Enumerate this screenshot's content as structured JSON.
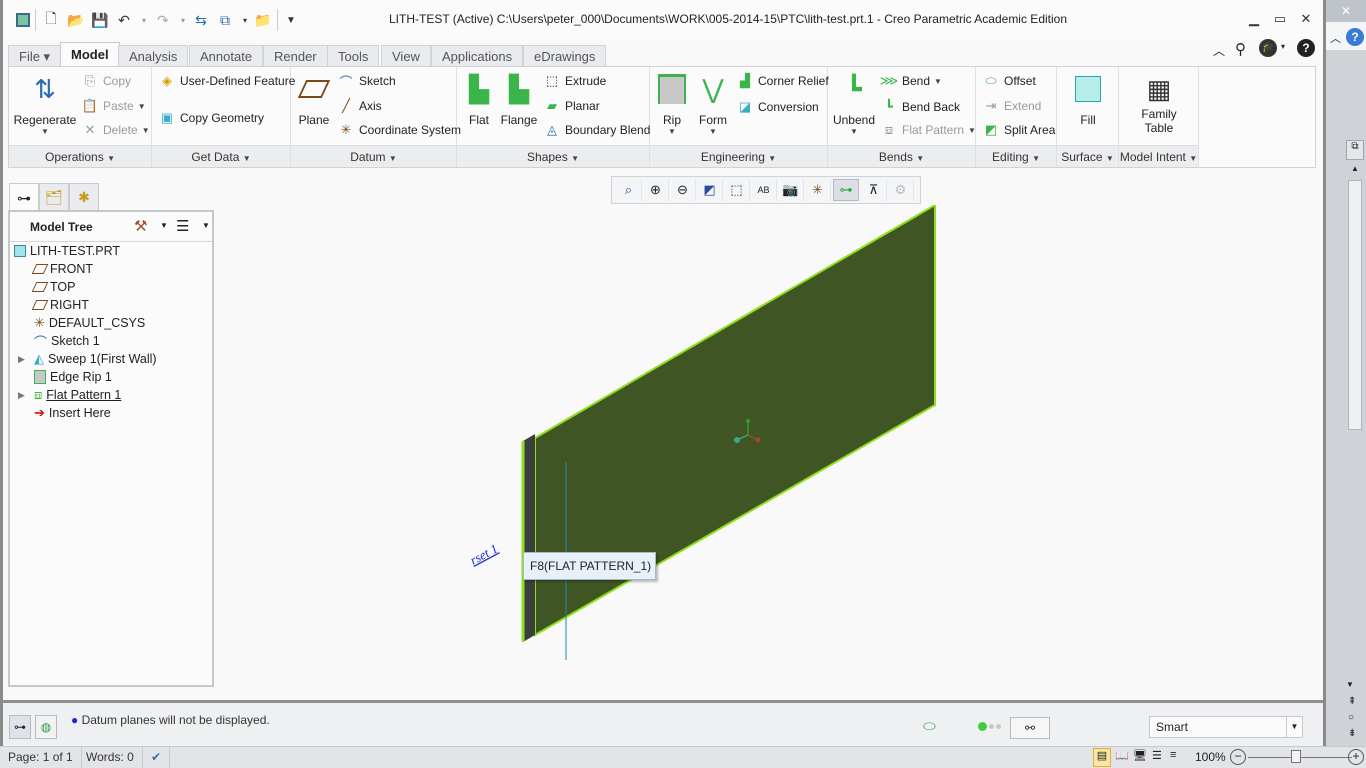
{
  "window": {
    "title": "LITH-TEST (Active) C:\\Users\\peter_000\\Documents\\WORK\\005-2014-15\\PTC\\lith-test.prt.1 - Creo Parametric Academic Edition",
    "controls": {
      "minimize": "minimize-icon",
      "restore": "restore-icon",
      "close": "close-icon"
    }
  },
  "quick_access": [
    "app-icon",
    "new-icon",
    "open-icon",
    "save-icon",
    "undo-icon",
    "redo-icon",
    "regenerate-icon",
    "windows-icon",
    "close-window-icon",
    "customize-icon"
  ],
  "menu_tabs": [
    {
      "label": "File ▾"
    },
    {
      "label": "Model",
      "active": true
    },
    {
      "label": "Analysis"
    },
    {
      "label": "Annotate"
    },
    {
      "label": "Render"
    },
    {
      "label": "Tools"
    },
    {
      "label": "View"
    },
    {
      "label": "Applications"
    },
    {
      "label": "eDrawings"
    }
  ],
  "ribbon": {
    "operations": {
      "label": "Operations",
      "regenerate": "Regenerate",
      "copy": "Copy",
      "paste": "Paste",
      "delete": "Delete"
    },
    "get_data": {
      "label": "Get Data",
      "udf": "User-Defined Feature",
      "copy_geometry": "Copy Geometry"
    },
    "datum": {
      "label": "Datum",
      "plane": "Plane",
      "sketch": "Sketch",
      "axis": "Axis",
      "csys": "Coordinate System"
    },
    "shapes": {
      "label": "Shapes",
      "flat": "Flat",
      "flange": "Flange",
      "extrude": "Extrude",
      "planar": "Planar",
      "boundary_blend": "Boundary Blend"
    },
    "engineering": {
      "label": "Engineering",
      "rip": "Rip",
      "form": "Form",
      "corner_relief": "Corner Relief",
      "conversion": "Conversion"
    },
    "bends": {
      "label": "Bends",
      "unbend": "Unbend",
      "bend": "Bend",
      "bend_back": "Bend Back",
      "flat_pattern": "Flat Pattern"
    },
    "editing": {
      "label": "Editing",
      "offset": "Offset",
      "extend": "Extend",
      "split_area": "Split Area"
    },
    "surface": {
      "label": "Surface",
      "fill": "Fill"
    },
    "model_intent": {
      "label": "Model Intent",
      "family_table_1": "Family",
      "family_table_2": "Table"
    }
  },
  "model_tree": {
    "title": "Model Tree",
    "items": [
      {
        "label": "LITH-TEST.PRT",
        "icon": "part-icon"
      },
      {
        "label": "FRONT",
        "icon": "datum-plane-icon"
      },
      {
        "label": "TOP",
        "icon": "datum-plane-icon"
      },
      {
        "label": "RIGHT",
        "icon": "datum-plane-icon"
      },
      {
        "label": "DEFAULT_CSYS",
        "icon": "csys-icon"
      },
      {
        "label": "Sketch 1",
        "icon": "sketch-icon"
      },
      {
        "label": "Sweep 1(First Wall)",
        "icon": "sweep-icon",
        "expandable": true
      },
      {
        "label": "Edge Rip 1",
        "icon": "rip-icon"
      },
      {
        "label": "Flat Pattern 1",
        "icon": "flat-pattern-icon",
        "expandable": true
      },
      {
        "label": "Insert Here",
        "icon": "insert-arrow-icon"
      }
    ]
  },
  "viewport": {
    "tooltip": "F8(FLAT PATTERN_1)",
    "annotation": "rset 1",
    "colors": {
      "face": "#3f5624",
      "edge": "#8fe01a",
      "background": "#f9f9f9"
    }
  },
  "message_area": {
    "message": "Datum planes will not be displayed.",
    "filter": "Smart"
  },
  "word_status": {
    "page": "Page: 1 of 1",
    "words": "Words: 0",
    "zoom": "100%"
  }
}
